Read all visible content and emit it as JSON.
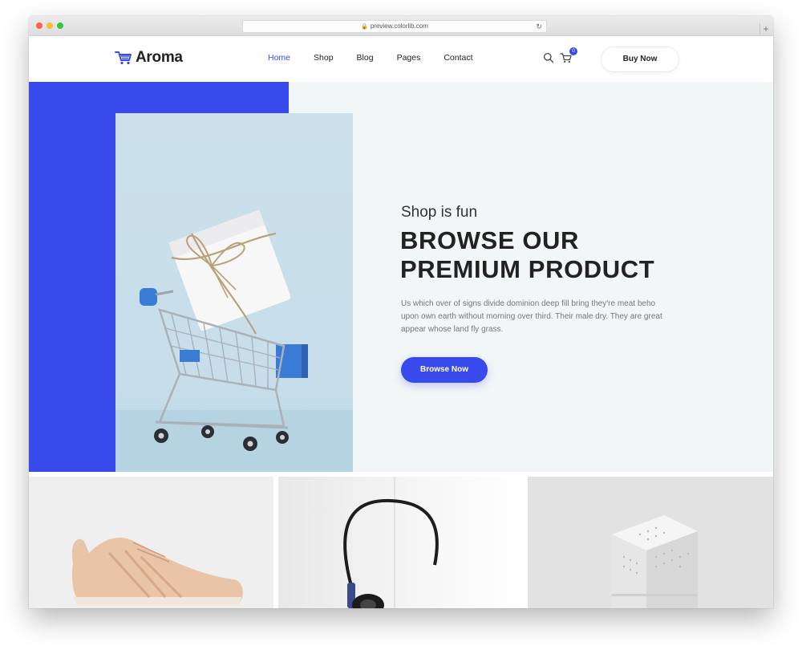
{
  "browser": {
    "url": "preview.colorlib.com",
    "new_tab": "+"
  },
  "header": {
    "logo_text": "Aroma",
    "nav": [
      {
        "label": "Home",
        "active": true
      },
      {
        "label": "Shop",
        "active": false
      },
      {
        "label": "Blog",
        "active": false
      },
      {
        "label": "Pages",
        "active": false
      },
      {
        "label": "Contact",
        "active": false
      }
    ],
    "cart_count": "0",
    "buy_now_label": "Buy Now"
  },
  "hero": {
    "subtitle": "Shop is fun",
    "title_line1": "BROWSE OUR",
    "title_line2": "PREMIUM PRODUCT",
    "description": "Us which over of signs divide dominion deep fill bring they're meat beho upon own earth without morning over third. Their male dry. They are great appear whose land fly grass.",
    "cta_label": "Browse Now"
  },
  "colors": {
    "accent": "#384aeb",
    "hero_bg": "#f1f6f7",
    "text_dark": "#222222",
    "text_muted": "#777777"
  },
  "icons": {
    "logo": "cart-logo-icon",
    "search": "search-icon",
    "cart": "cart-icon"
  }
}
